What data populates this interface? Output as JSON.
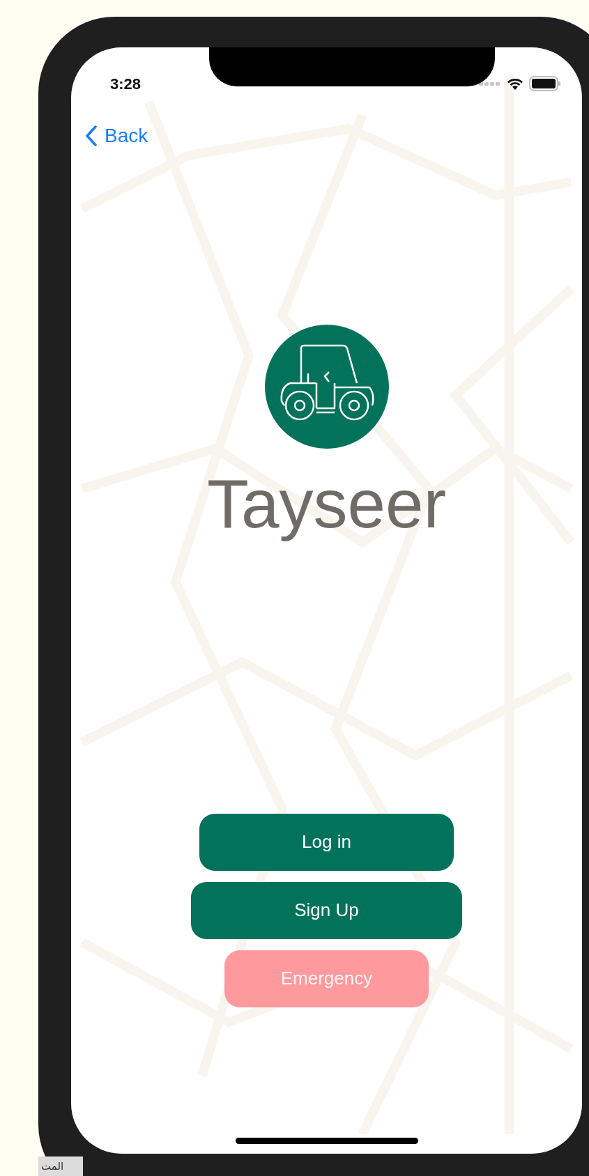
{
  "status_bar": {
    "time": "3:28"
  },
  "nav": {
    "back_label": "Back"
  },
  "app": {
    "title": "Tayseer"
  },
  "buttons": [
    {
      "label": "Log in",
      "kind": "primary"
    },
    {
      "label": "Sign Up",
      "kind": "wide"
    },
    {
      "label": "Emergency",
      "kind": "emergency"
    }
  ],
  "background_text": "المت"
}
